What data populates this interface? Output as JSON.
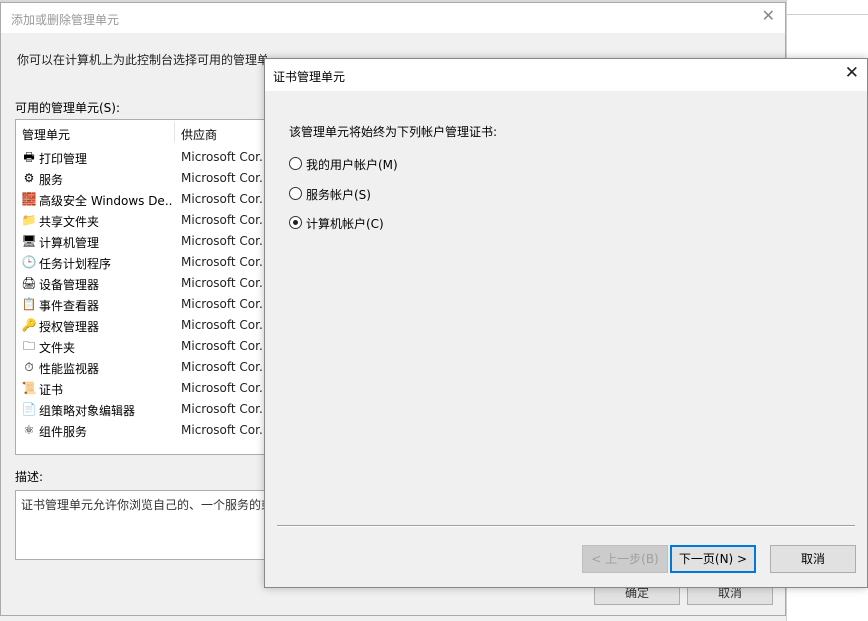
{
  "back_dialog": {
    "title": "添加或删除管理单元",
    "description": "你可以在计算机上为此控制台选择可用的管理单元并配置所选的一组管理单元。对于可扩展的管理单元，你可以配置要启用哪些扩展项。",
    "available_label": "可用的管理单元(S):",
    "columns": {
      "name": "管理单元",
      "vendor": "供应商"
    },
    "snapins": [
      {
        "name": "打印管理",
        "vendor": "Microsoft Cor..."
      },
      {
        "name": "服务",
        "vendor": "Microsoft Cor..."
      },
      {
        "name": "高级安全 Windows De...",
        "vendor": "Microsoft Cor..."
      },
      {
        "name": "共享文件夹",
        "vendor": "Microsoft Cor..."
      },
      {
        "name": "计算机管理",
        "vendor": "Microsoft Cor..."
      },
      {
        "name": "任务计划程序",
        "vendor": "Microsoft Cor..."
      },
      {
        "name": "设备管理器",
        "vendor": "Microsoft Cor..."
      },
      {
        "name": "事件查看器",
        "vendor": "Microsoft Cor..."
      },
      {
        "name": "授权管理器",
        "vendor": "Microsoft Cor..."
      },
      {
        "name": "文件夹",
        "vendor": "Microsoft Cor..."
      },
      {
        "name": "性能监视器",
        "vendor": "Microsoft Cor..."
      },
      {
        "name": "证书",
        "vendor": "Microsoft Cor..."
      },
      {
        "name": "组策略对象编辑器",
        "vendor": "Microsoft Cor..."
      },
      {
        "name": "组件服务",
        "vendor": "Microsoft Cor..."
      }
    ],
    "desc_label": "描述:",
    "desc_text": "证书管理单元允许你浏览自己的、一个服务的或",
    "ok_label": "确定",
    "cancel_label": "取消"
  },
  "cert_dialog": {
    "title": "证书管理单元",
    "prompt": "该管理单元将始终为下列帐户管理证书:",
    "options": [
      {
        "label": "我的用户帐户(M)",
        "selected": false
      },
      {
        "label": "服务帐户(S)",
        "selected": false
      },
      {
        "label": "计算机帐户(C)",
        "selected": true
      }
    ],
    "back_label": "< 上一步(B)",
    "next_label": "下一页(N) >",
    "cancel_label": "取消"
  },
  "colors": {
    "accent": "#0078d7"
  }
}
